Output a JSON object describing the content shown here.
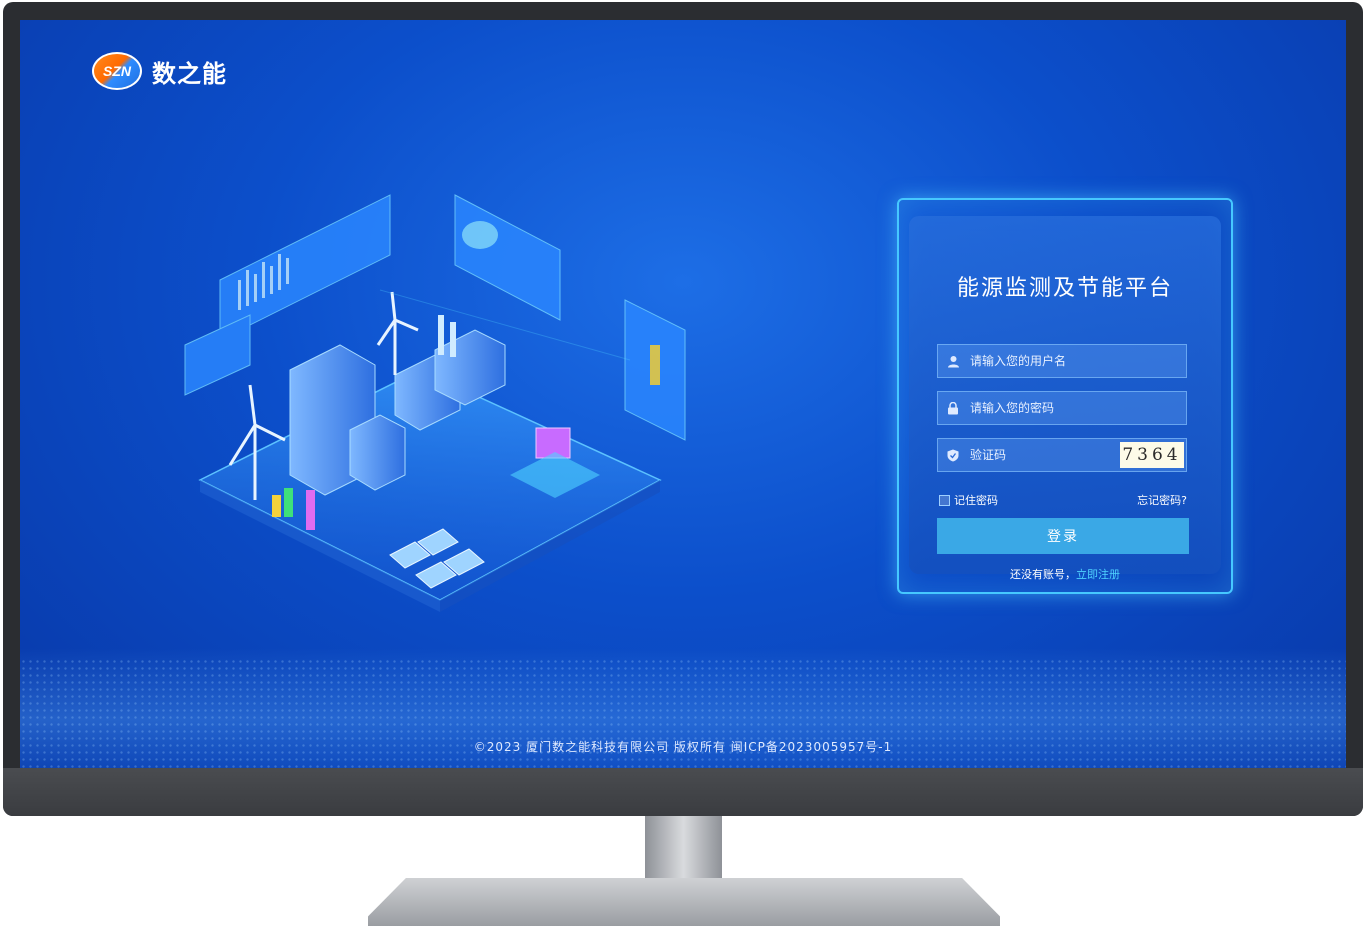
{
  "brand": {
    "logo_mark": "SZN",
    "name": "数之能"
  },
  "login": {
    "title": "能源监测及节能平台",
    "username_placeholder": "请输入您的用户名",
    "password_placeholder": "请输入您的密码",
    "captcha_placeholder": "验证码",
    "captcha_code": "7364",
    "remember_label": "记住密码",
    "forgot_label": "忘记密码?",
    "submit_label": "登录",
    "register_prompt": "还没有账号，",
    "register_link": "立即注册"
  },
  "footer": {
    "copyright": "©2023 厦门数之能科技有限公司 版权所有 闽ICP备2023005957号-1"
  },
  "icons": {
    "username": "user-icon",
    "password": "lock-icon",
    "captcha": "shield-icon"
  },
  "colors": {
    "screen_blue": "#0c4fcb",
    "panel_border": "#46c8ff",
    "button": "#3aa8e6",
    "link": "#4fd2ff",
    "logo_orange": "#ff6a00"
  }
}
